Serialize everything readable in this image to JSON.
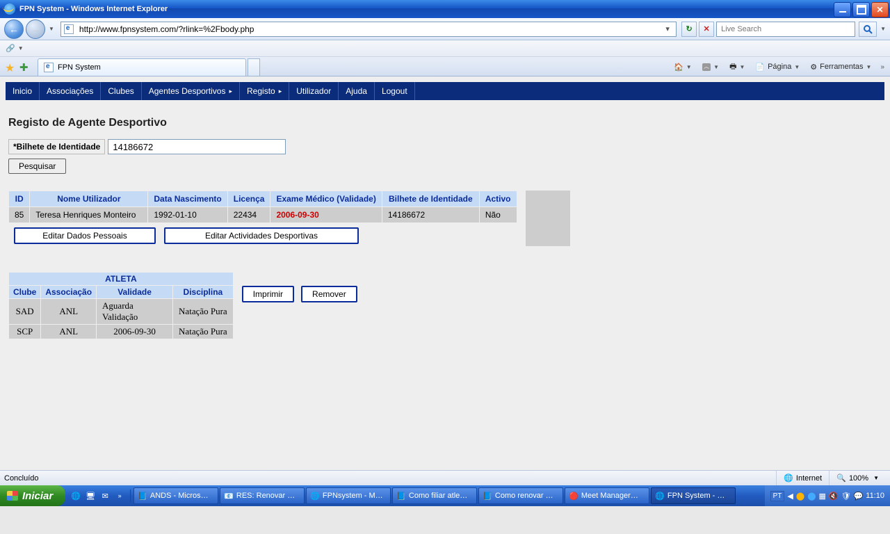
{
  "window": {
    "title": "FPN System - Windows Internet Explorer"
  },
  "address": {
    "url": "http://www.fpnsystem.com/?rlink=%2Fbody.php"
  },
  "search": {
    "placeholder": "Live Search"
  },
  "tab": {
    "title": "FPN System"
  },
  "cmdbar": {
    "page": "Página",
    "tools": "Ferramentas"
  },
  "menu": {
    "items": [
      "Inicio",
      "Associações",
      "Clubes",
      "Agentes Desportivos",
      "Registo",
      "Utilizador",
      "Ajuda",
      "Logout"
    ],
    "has_arrow": [
      false,
      false,
      false,
      true,
      true,
      false,
      false,
      false
    ]
  },
  "page_title": "Registo de Agente Desportivo",
  "form": {
    "bi_label": "*Bilhete de Identidade",
    "bi_value": "14186672",
    "search_btn": "Pesquisar"
  },
  "agent_table": {
    "headers": [
      "ID",
      "Nome Utilizador",
      "Data Nascimento",
      "Licença",
      "Exame Médico (Validade)",
      "Bilhete de Identidade",
      "Activo"
    ],
    "row": {
      "id": "85",
      "nome": "Teresa Henriques Monteiro",
      "nasc": "1992-01-10",
      "lic": "22434",
      "exame": "2006-09-30",
      "bi": "14186672",
      "activo": "Não"
    },
    "btn_edit_personal": "Editar Dados Pessoais",
    "btn_edit_activities": "Editar Actividades Desportivas"
  },
  "atleta": {
    "title": "ATLETA",
    "headers": [
      "Clube",
      "Associação",
      "Validade",
      "Disciplina"
    ],
    "rows": [
      {
        "clube": "SAD",
        "assoc": "ANL",
        "val": "Aguarda Validação",
        "disc": "Natação Pura"
      },
      {
        "clube": "SCP",
        "assoc": "ANL",
        "val": "2006-09-30",
        "disc": "Natação Pura"
      }
    ],
    "btn_print": "Imprimir",
    "btn_remove": "Remover"
  },
  "status": {
    "left": "Concluído",
    "zone": "Internet",
    "zoom": "100%"
  },
  "taskbar": {
    "start": "Iniciar",
    "lang": "PT",
    "clock": "11:10",
    "tasks": [
      "ANDS - Micros…",
      "RES: Renovar …",
      "FPNsystem - M…",
      "Como filiar atle…",
      "Como renovar …",
      "Meet Manager…",
      "FPN System - …"
    ]
  }
}
